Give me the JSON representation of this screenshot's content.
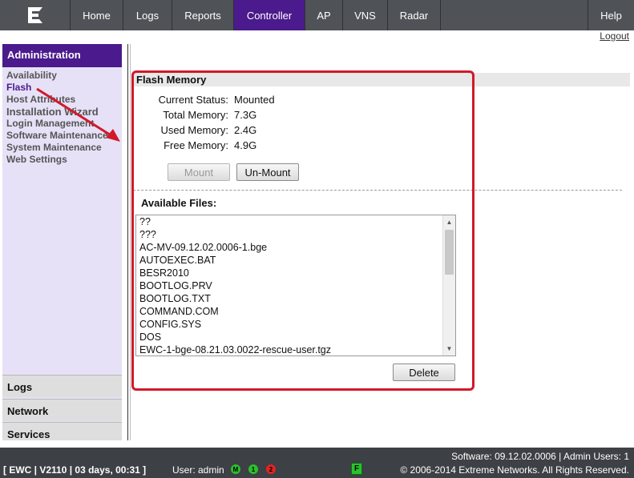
{
  "nav": {
    "tabs": [
      {
        "label": "Home",
        "active": false
      },
      {
        "label": "Logs",
        "active": false
      },
      {
        "label": "Reports",
        "active": false
      },
      {
        "label": "Controller",
        "active": true
      },
      {
        "label": "AP",
        "active": false
      },
      {
        "label": "VNS",
        "active": false
      },
      {
        "label": "Radar",
        "active": false
      }
    ],
    "help": "Help",
    "logout": "Logout",
    "logo_icon": "extreme-networks-logo"
  },
  "sidebar": {
    "header": "Administration",
    "items": [
      {
        "label": "Availability",
        "active": false
      },
      {
        "label": "Flash",
        "active": true
      },
      {
        "label": "Host Attributes",
        "active": false
      },
      {
        "label": "Installation Wizard",
        "active": false
      },
      {
        "label": "Login Management",
        "active": false
      },
      {
        "label": "Software Maintenance",
        "active": false
      },
      {
        "label": "System Maintenance",
        "active": false
      },
      {
        "label": "Web Settings",
        "active": false
      }
    ],
    "sections": [
      "Logs",
      "Network",
      "Services"
    ]
  },
  "flash": {
    "title": "Flash Memory",
    "fields": [
      {
        "label": "Current Status:",
        "value": "Mounted"
      },
      {
        "label": "Total Memory:",
        "value": "7.3G"
      },
      {
        "label": "Used Memory:",
        "value": "2.4G"
      },
      {
        "label": "Free Memory:",
        "value": "4.9G"
      }
    ],
    "mount_label": "Mount",
    "unmount_label": "Un-Mount",
    "files_label": "Available Files:",
    "files": [
      "??",
      "???",
      "AC-MV-09.12.02.0006-1.bge",
      "AUTOEXEC.BAT",
      "BESR2010",
      "BOOTLOG.PRV",
      "BOOTLOG.TXT",
      "COMMAND.COM",
      "CONFIG.SYS",
      "DOS",
      "EWC-1-bge-08.21.03.0022-rescue-user.tgz"
    ],
    "delete_label": "Delete"
  },
  "footer": {
    "status": "[ EWC | V2110 | 03 days, 00:31 ]",
    "user": "User: admin",
    "indicators": [
      {
        "text": "M",
        "color": "#2bc02b"
      },
      {
        "text": "1",
        "color": "#2bc02b"
      },
      {
        "text": "2",
        "color": "#e02424"
      }
    ],
    "badge": "F",
    "software": "Software: 09.12.02.0006 | Admin Users: 1",
    "copyright": "© 2006-2014  Extreme Networks. All Rights Reserved."
  },
  "colors": {
    "accent": "#4b1a8c",
    "annotation": "#d2192a"
  }
}
